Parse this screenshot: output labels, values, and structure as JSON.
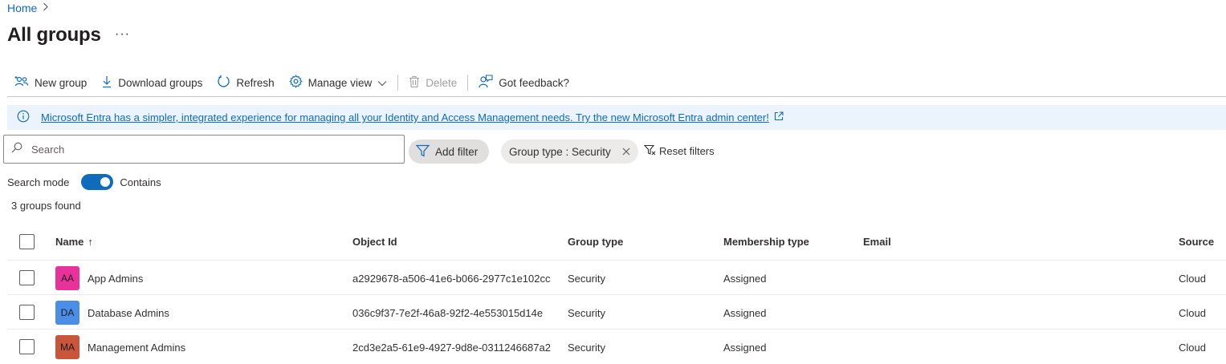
{
  "breadcrumb": {
    "home": "Home"
  },
  "page": {
    "title": "All groups",
    "more": "···"
  },
  "toolbar": {
    "new_group": "New group",
    "download_groups": "Download groups",
    "refresh": "Refresh",
    "manage_view": "Manage view",
    "delete": "Delete",
    "feedback": "Got feedback?"
  },
  "banner": {
    "text": "Microsoft Entra has a simpler, integrated experience for managing all your Identity and Access Management needs. Try the new Microsoft Entra admin center!"
  },
  "search": {
    "placeholder": "Search",
    "value": ""
  },
  "filters": {
    "add_filter": "Add filter",
    "active_filter": "Group type : Security",
    "reset": "Reset filters"
  },
  "search_mode": {
    "label": "Search mode",
    "value": "Contains",
    "enabled": true
  },
  "results": {
    "count_text": "3 groups found"
  },
  "table": {
    "columns": {
      "name": "Name",
      "sort_indicator": "↑",
      "object_id": "Object Id",
      "group_type": "Group type",
      "membership_type": "Membership type",
      "email": "Email",
      "source": "Source"
    },
    "rows": [
      {
        "initials": "AA",
        "avatar_color": "#e8319a",
        "name": "App Admins",
        "object_id": "a2929678-a506-41e6-b066-2977c1e102cc",
        "group_type": "Security",
        "membership_type": "Assigned",
        "email": "",
        "source": "Cloud"
      },
      {
        "initials": "DA",
        "avatar_color": "#4a8ee8",
        "name": "Database Admins",
        "object_id": "036c9f37-7e2f-46a8-92f2-4e553015d14e",
        "group_type": "Security",
        "membership_type": "Assigned",
        "email": "",
        "source": "Cloud"
      },
      {
        "initials": "MA",
        "avatar_color": "#c9563a",
        "name": "Management Admins",
        "object_id": "2cd3e2a5-61e9-4927-9d8e-0311246687a2",
        "group_type": "Security",
        "membership_type": "Assigned",
        "email": "",
        "source": "Cloud"
      }
    ]
  },
  "colors": {
    "accent": "#0f6cbd",
    "banner_bg": "#ebf3fc"
  }
}
